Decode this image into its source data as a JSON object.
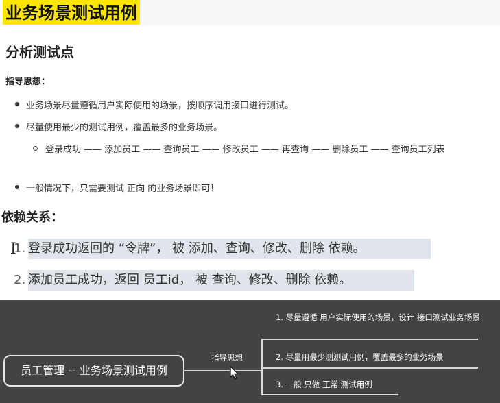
{
  "header": {
    "title": "业务场景测试用例"
  },
  "analysis": {
    "heading": "分析测试点",
    "guide_label": "指导思想：",
    "bullets": [
      "业务场景尽量遵循用户实际使用的场景，按顺序调用接口进行测试。",
      "尽量使用最少的测试用例，覆盖最多的业务场景。",
      "一般情况下，只需要测试 正向 的业务场景即可！"
    ],
    "sub_bullet": "登录成功 —— 添加员工 —— 查询员工 —— 修改员工 —— 再查询 —— 删除员工 —— 查询员工列表"
  },
  "dependency": {
    "heading": "依赖关系：",
    "items": [
      {
        "num": "1.",
        "text": "登录成功返回的 “令牌”， 被 添加、查询、修改、删除 依赖。"
      },
      {
        "num": "2.",
        "text": "添加员工成功，返回 员工id， 被 查询、修改、删除 依赖。"
      }
    ]
  },
  "mindmap": {
    "root": "员工管理 -- 业务场景测试用例",
    "branch_label": "指导思想",
    "branches": [
      "1. 尽量遵循 用户实际使用的场景，设计 接口测试业务场景",
      "2. 尽量用最少测测试用例，覆盖最多的业务场景",
      "3. 一般 只做 正常 测试用例"
    ]
  },
  "colors": {
    "title_highlight": "#ffe600",
    "dependency_highlight": "#dfe5eb",
    "mindmap_background": "#434343"
  }
}
